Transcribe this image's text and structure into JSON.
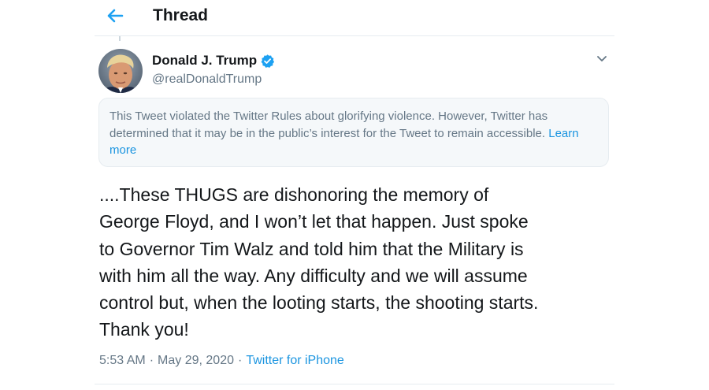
{
  "header": {
    "title": "Thread",
    "back_icon": "back-arrow-icon"
  },
  "colors": {
    "accent": "#1da1f2",
    "link": "#1b95e0",
    "secondary_text": "#657786",
    "notice_background": "#f5f8fa"
  },
  "tweet": {
    "author": {
      "display_name": "Donald J. Trump",
      "handle": "@realDonaldTrump",
      "verified_icon": "verified-badge-icon"
    },
    "menu_icon": "chevron-down-icon",
    "notice": {
      "text": "This Tweet violated the Twitter Rules about glorifying violence. However, Twitter has determined that it may be in the public’s interest for the Tweet to remain accessible.",
      "link": "Learn more"
    },
    "text_lines": [
      "....These THUGS are dishonoring the memory of",
      "George Floyd, and I won’t let that happen. Just spoke",
      "to Governor Tim Walz and told him that the Military is",
      "with him all the way. Any difficulty and we will assume",
      "control but, when the looting starts, the shooting starts.",
      "Thank you!"
    ],
    "time": "5:53 AM",
    "date": "May 29, 2020",
    "separator": "·",
    "source": "Twitter for iPhone"
  }
}
